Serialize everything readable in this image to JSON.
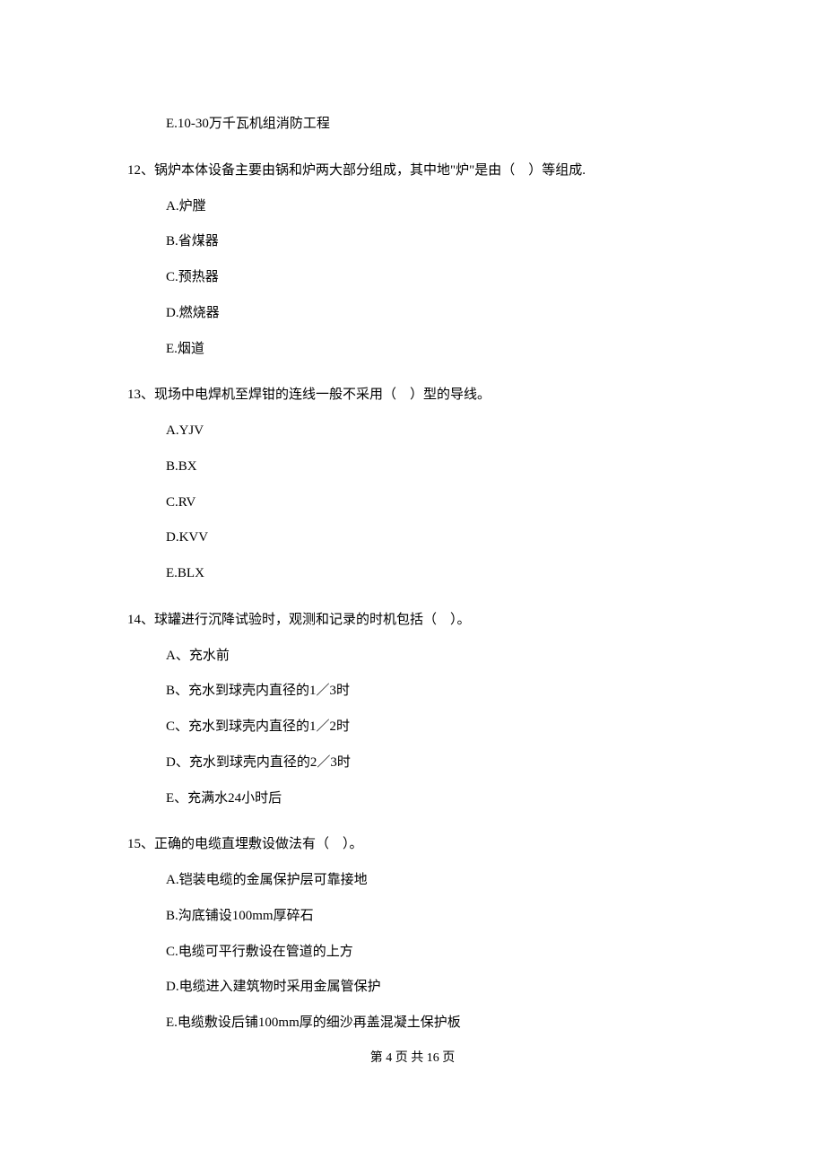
{
  "q11": {
    "options": {
      "E": "E.10-30万千瓦机组消防工程"
    }
  },
  "q12": {
    "text": "12、锅炉本体设备主要由锅和炉两大部分组成，其中地\"炉\"是由（    ）等组成.",
    "options": {
      "A": "A.炉膛",
      "B": "B.省煤器",
      "C": "C.预热器",
      "D": "D.燃烧器",
      "E": "E.烟道"
    }
  },
  "q13": {
    "text": "13、现场中电焊机至焊钳的连线一般不采用（    ）型的导线。",
    "options": {
      "A": "A.YJV",
      "B": "B.BX",
      "C": "C.RV",
      "D": "D.KVV",
      "E": "E.BLX"
    }
  },
  "q14": {
    "text": "14、球罐进行沉降试验时，观测和记录的时机包括（    ）。",
    "options": {
      "A": "A、充水前",
      "B": "B、充水到球壳内直径的1／3时",
      "C": "C、充水到球壳内直径的1／2时",
      "D": "D、充水到球壳内直径的2／3时",
      "E": "E、充满水24小时后"
    }
  },
  "q15": {
    "text": "15、正确的电缆直埋敷设做法有（    ）。",
    "options": {
      "A": "A.铠装电缆的金属保护层可靠接地",
      "B": "B.沟底铺设100mm厚碎石",
      "C": "C.电缆可平行敷设在管道的上方",
      "D": "D.电缆进入建筑物时采用金属管保护",
      "E": "E.电缆敷设后铺100mm厚的细沙再盖混凝土保护板"
    }
  },
  "footer": "第 4 页 共 16 页"
}
